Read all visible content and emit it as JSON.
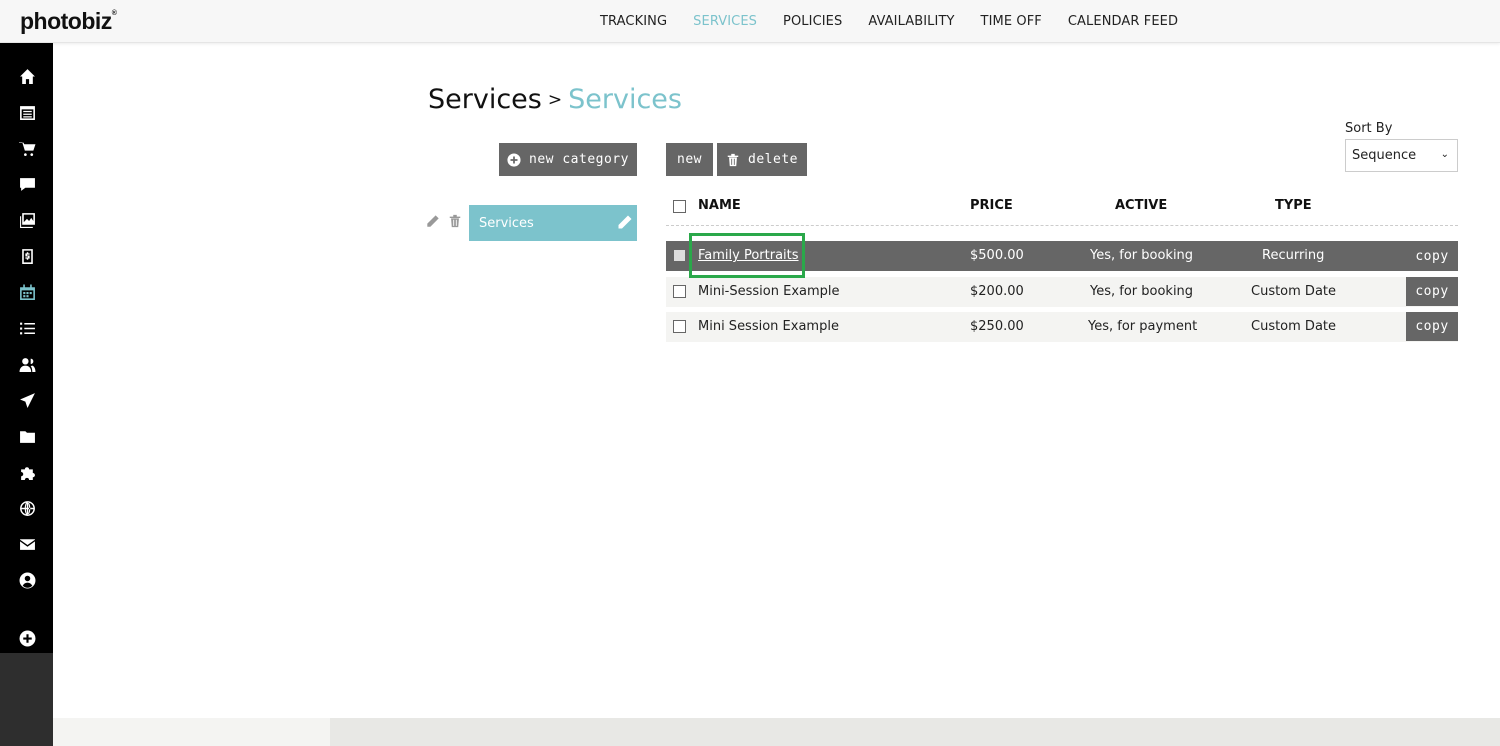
{
  "app": {
    "logo": "photobiz",
    "logo_mark": "®"
  },
  "topnav": [
    {
      "label": "TRACKING",
      "active": false
    },
    {
      "label": "SERVICES",
      "active": true
    },
    {
      "label": "POLICIES",
      "active": false
    },
    {
      "label": "AVAILABILITY",
      "active": false
    },
    {
      "label": "TIME OFF",
      "active": false
    },
    {
      "label": "CALENDAR FEED",
      "active": false
    }
  ],
  "sidebar": {
    "icons": [
      "home-icon",
      "calendar-list-icon",
      "cart-icon",
      "chat-icon",
      "gallery-icon",
      "invoice-icon",
      "scheduler-icon",
      "list-icon",
      "contacts-icon",
      "send-icon",
      "folder-icon",
      "puzzle-icon",
      "globe-icon",
      "mail-icon",
      "account-icon",
      "add-icon"
    ]
  },
  "breadcrumb": {
    "parent": "Services",
    "separator": ">",
    "current": "Services"
  },
  "toolbar": {
    "new_category_label": "new category",
    "new_label": "new",
    "delete_label": "delete"
  },
  "categories": [
    {
      "label": "Services"
    }
  ],
  "sort": {
    "label": "Sort By",
    "value": "Sequence"
  },
  "table": {
    "headers": {
      "name": "NAME",
      "price": "PRICE",
      "active": "ACTIVE",
      "type": "TYPE"
    },
    "copy_label": "copy",
    "rows": [
      {
        "name": "Family Portraits",
        "price": "$500.00",
        "active": "Yes, for booking",
        "type": "Recurring",
        "selected": true
      },
      {
        "name": "Mini-Session Example",
        "price": "$200.00",
        "active": "Yes, for booking",
        "type": "Custom Date",
        "selected": false
      },
      {
        "name": "Mini Session Example",
        "price": "$250.00",
        "active": "Yes, for payment",
        "type": "Custom Date",
        "selected": false
      }
    ]
  },
  "colors": {
    "accent": "#7cc3cc",
    "button": "#666666",
    "highlight": "#2aa84a"
  }
}
